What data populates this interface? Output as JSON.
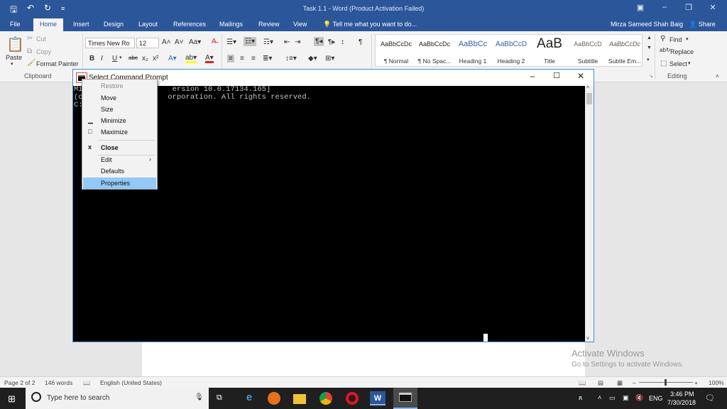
{
  "word": {
    "title": "Task 1.1 - Word (Product Activation Failed)",
    "tabs": [
      "File",
      "Home",
      "Insert",
      "Design",
      "Layout",
      "References",
      "Mailings",
      "Review",
      "View"
    ],
    "tell_me": "Tell me what you want to do...",
    "user": "Mirza Sameed Shah Baig",
    "share": "Share",
    "clipboard": {
      "paste": "Paste",
      "cut": "Cut",
      "copy": "Copy",
      "format_painter": "Format Painter",
      "label": "Clipboard"
    },
    "font": {
      "name": "Times New Ro",
      "size": "12"
    },
    "styles": [
      {
        "sample": "AaBbCcDc",
        "name": "¶ Normal"
      },
      {
        "sample": "AaBbCcDc",
        "name": "¶ No Spac..."
      },
      {
        "sample": "AaBbCc",
        "name": "Heading 1"
      },
      {
        "sample": "AaBbCcD",
        "name": "Heading 2"
      },
      {
        "sample": "AaB",
        "name": "Title"
      },
      {
        "sample": "AaBbCcD",
        "name": "Subtitle"
      },
      {
        "sample": "AaBbCcDc",
        "name": "Subtle Em..."
      }
    ],
    "editing": {
      "find": "Find",
      "replace": "Replace",
      "select": "Select",
      "label": "Editing"
    },
    "watermark": {
      "line1": "Activate Windows",
      "line2": "Go to Settings to activate Windows."
    },
    "status": {
      "page": "Page 2 of 2",
      "words": "146 words",
      "language": "English (United States)",
      "zoom": "100%"
    }
  },
  "cmd": {
    "title": "Select Command Prompt",
    "lines": [
      "Mi                    ersion 10.0.17134.165]",
      "(c                   orporation. All rights reserved.",
      "",
      "C:"
    ]
  },
  "system_menu": {
    "items": [
      {
        "label": "Restore",
        "glyph": "",
        "disabled": true
      },
      {
        "label": "Move",
        "glyph": ""
      },
      {
        "label": "Size",
        "glyph": ""
      },
      {
        "label": "Minimize",
        "glyph": "▁"
      },
      {
        "label": "Maximize",
        "glyph": "□"
      },
      {
        "label": "Close",
        "glyph": "x",
        "bold": true
      },
      {
        "label": "Edit",
        "glyph": "",
        "submenu": true
      },
      {
        "label": "Defaults",
        "glyph": ""
      },
      {
        "label": "Properties",
        "glyph": "",
        "highlighted": true
      }
    ]
  },
  "taskbar": {
    "search_placeholder": "Type here to search",
    "language": "ENG",
    "time": "3:46 PM",
    "date": "7/30/2018"
  },
  "colors": {
    "word_blue": "#2b579a",
    "menu_highlight": "#91c9f7",
    "cmd_border": "#3c8fd6"
  }
}
